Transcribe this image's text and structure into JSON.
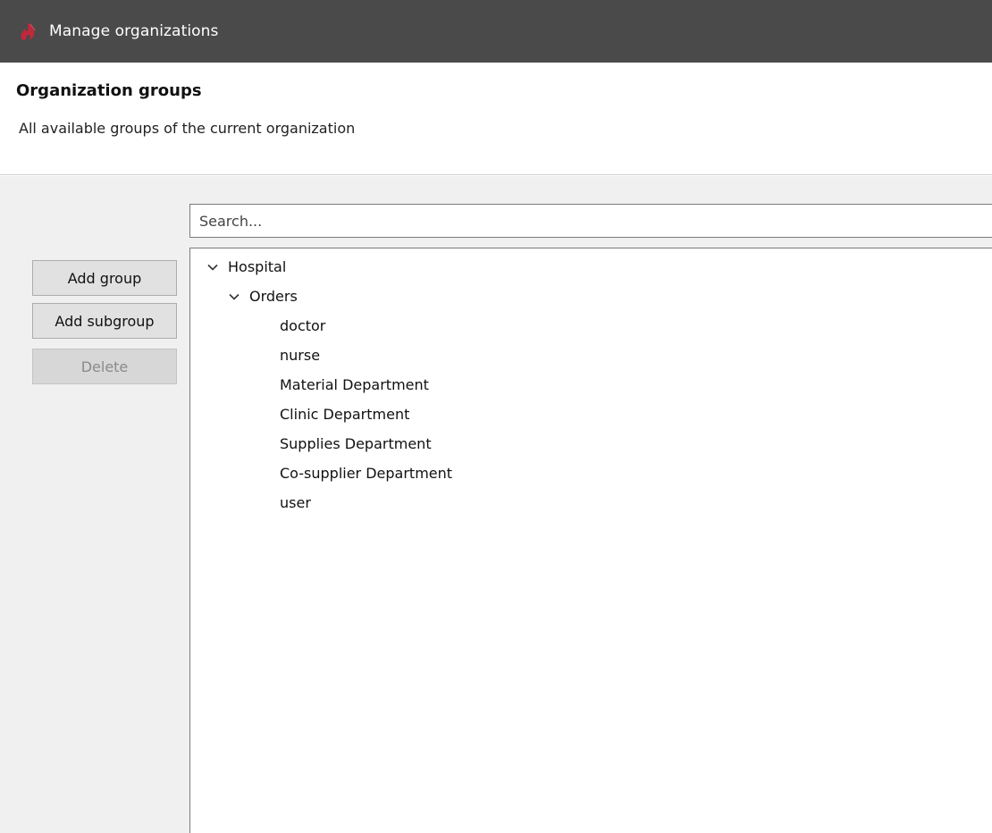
{
  "window": {
    "title": "Manage organizations"
  },
  "header": {
    "title": "Organization groups",
    "description": "All available groups of the current organization"
  },
  "search": {
    "placeholder": "Search...",
    "value": ""
  },
  "buttons": {
    "add_group": "Add group",
    "add_subgroup": "Add subgroup",
    "delete": "Delete"
  },
  "tree": {
    "root": {
      "label": "Hospital",
      "expanded": true,
      "children": [
        {
          "label": "Orders",
          "expanded": true,
          "children": [
            {
              "label": "doctor"
            },
            {
              "label": "nurse"
            },
            {
              "label": "Material Department"
            },
            {
              "label": "Clinic Department"
            },
            {
              "label": "Supplies Department"
            },
            {
              "label": "Co-supplier Department"
            },
            {
              "label": "user"
            }
          ]
        }
      ]
    }
  },
  "colors": {
    "titlebar": "#4a4a4a",
    "app_icon": "#c0283b",
    "panel_background": "#f0f0f0"
  }
}
